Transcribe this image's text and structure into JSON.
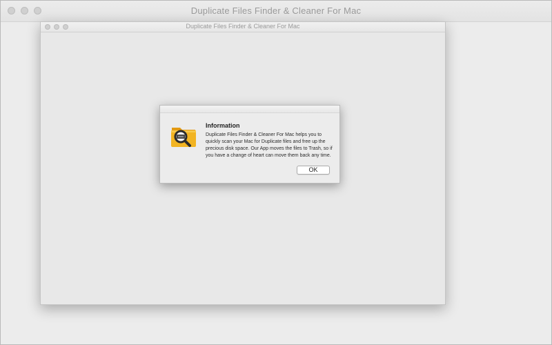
{
  "app": {
    "window_title": "Duplicate Files Finder & Cleaner For Mac",
    "inner_window_title": "Duplicate Files Finder & Cleaner For Mac"
  },
  "dialog": {
    "title": "Information",
    "message": "Duplicate Files Finder & Cleaner For Mac helps you to quickly scan your Mac for Duplicate files and free up the precious disk space.  Our App moves the files to Trash, so if you have a change of heart can move them back any time.",
    "ok_label": "OK",
    "icon": "folder-magnifier-icon"
  },
  "colors": {
    "folder": "#f2b422",
    "folder_tab": "#e39a12",
    "lens_ring": "#2b2b2b"
  }
}
